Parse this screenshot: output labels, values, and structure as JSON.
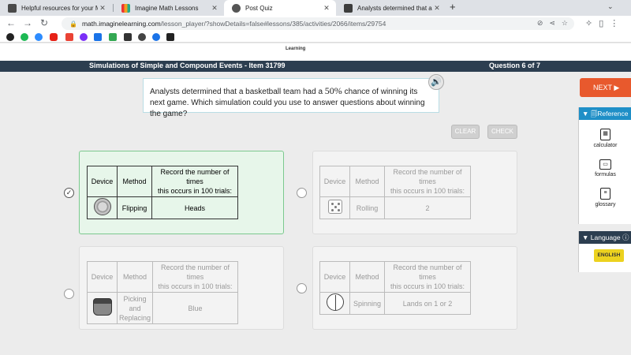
{
  "browser": {
    "tabs": [
      {
        "title": "Helpful resources for your Mark",
        "icon_color": "#4a4a4a"
      },
      {
        "title": "Imagine Math Lessons",
        "icon_color": "#f0a020"
      },
      {
        "title": "Post Quiz",
        "icon_color": "#555555"
      },
      {
        "title": "Analysts determined that a bask",
        "icon_color": "#3d3d3d"
      }
    ],
    "url_host": "math.imaginelearning.com",
    "url_path": "/lesson_player/?showDetails=false#lessons/385/activities/2066/items/29754"
  },
  "page": {
    "brand_fragment": "Learning",
    "header_title": "Simulations of Simple and Compound Events - Item 31799",
    "question_counter": "Question 6 of 7",
    "question_text_before": "Analysts determined that a basketball team had a ",
    "question_percent": "50%",
    "question_text_after": " chance of winning its next game. Which simulation could you use to answer questions about winning the game?",
    "clear_label": "CLEAR",
    "check_label": "CHECK"
  },
  "table_headers": {
    "device": "Device",
    "method": "Method",
    "record_line1": "Record the number of",
    "record_line2": "times",
    "record_line3": "this occurs in 100 trials:"
  },
  "options": [
    {
      "device_icon": "coin-icon",
      "method": "Flipping",
      "result": "Heads",
      "selected": true
    },
    {
      "device_icon": "die-icon",
      "method": "Rolling",
      "result": "2",
      "selected": false
    },
    {
      "device_icon": "hat-icon",
      "method": "Picking and Replacing",
      "result": "Blue",
      "selected": false
    },
    {
      "device_icon": "spinner-icon",
      "method": "Spinning",
      "result": "Lands on 1 or 2",
      "selected": false
    }
  ],
  "sidebar": {
    "next_label": "NEXT ▶",
    "reference_label": "▼ 🗐Reference",
    "calculator_label": "calculator",
    "formulas_label": "formulas",
    "glossary_label": "glossary",
    "language_label": "▼ Language",
    "english_label": "ENGLISH"
  },
  "colors": {
    "header_bg": "#2c3e50",
    "next_bg": "#e8592d",
    "reference_bg": "#1f8fc7",
    "english_bg": "#ecd21f",
    "selected_card_bg": "#e7f6ea"
  }
}
